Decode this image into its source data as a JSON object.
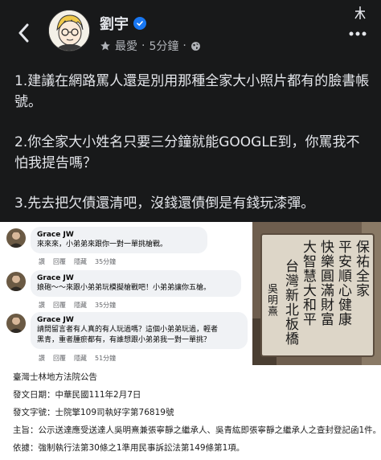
{
  "header": {
    "author": "劉宇",
    "audience": "最愛",
    "separator": "·",
    "time": "5分鐘",
    "separator2": "·"
  },
  "post": {
    "paragraphs": [
      "1.建議在網路罵人還是別用那種全家大小照片都有的臉書帳號。",
      "2.你全家大小姓名只要三分鐘就能GOOGLE到，你罵我不怕我提告嗎？",
      "3.先去把欠債還清吧，沒錢還債倒是有錢玩漆彈。"
    ]
  },
  "comments": [
    {
      "name": "Grace JW",
      "text": "來來來，小弟弟來跟你一對一單挑槍戰。",
      "like": "讚",
      "reply": "回覆",
      "hide": "隱藏",
      "time": "35分鐘"
    },
    {
      "name": "Grace JW",
      "text": "娘砲～～來跟小弟弟玩模擬槍戰吧！小弟弟讓你五槍。",
      "like": "讚",
      "reply": "回覆",
      "hide": "隱藏",
      "time": "35分鐘"
    },
    {
      "name": "Grace JW",
      "text_line1": "請問留言者有人真的有人玩過嗎？這個小弟弟玩過，輕者",
      "text_line2": "黑青，重者腫瘀都有，有誰想跟小弟弟我一對一單挑？",
      "like": "讚",
      "reply": "回覆",
      "hide": "隱藏",
      "time": "51分鐘"
    }
  ],
  "sign": {
    "col1": "保祐全家",
    "col2": "平安順心健康",
    "col3": "快樂圓滿財富",
    "col4": "大智慧大和平",
    "col5": "台灣新北板橋",
    "col6": "吳明熹"
  },
  "notice": {
    "court": "臺灣士林地方法院公告",
    "date": "發文日期：中華民國111年2月7日",
    "number": "發文字號：士院擎109司執好字第76819號",
    "subject": "主旨：公示送達應受送達人吳明熹兼張寧靜之繼承人、吳青紘即張寧靜之繼承人之查封登記函1件。",
    "basis": "依據：強制執行法第30條之1準用民事訴訟法第149條第1項。"
  }
}
